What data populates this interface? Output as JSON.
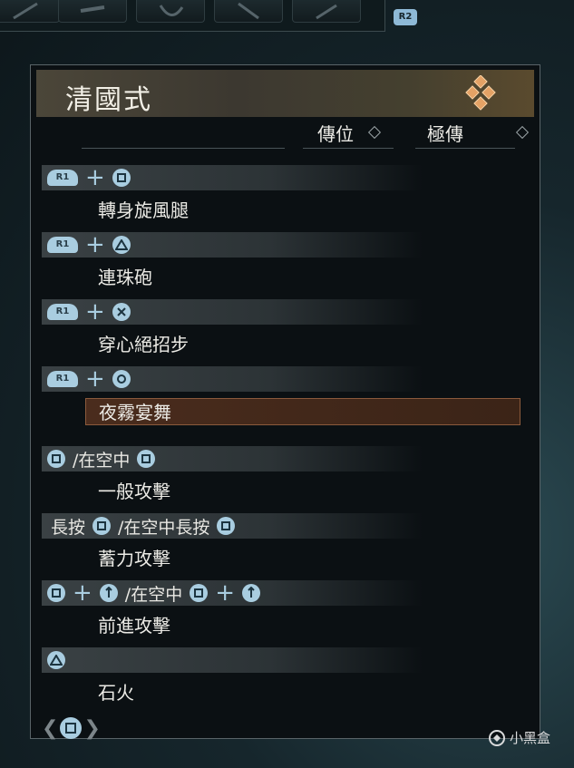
{
  "top_bar": {
    "slot_count": 5,
    "r2_label": "R2"
  },
  "panel": {
    "title": "清國式",
    "tabs": [
      "傳位",
      "極傳"
    ],
    "moves": [
      {
        "keys": "R1 + □",
        "name": "轉身旋風腿"
      },
      {
        "keys": "R1 + △",
        "name": "連珠砲"
      },
      {
        "keys": "R1 + ×",
        "name": "穿心絕招步"
      },
      {
        "keys": "R1 + ○",
        "name": "夜霧宴舞",
        "selected": true
      },
      {
        "keys": "□ /在空中 □",
        "name": "一般攻擊"
      },
      {
        "keys": "長按 □ /在空中長按 □",
        "name": "蓄力攻擊"
      },
      {
        "keys": "□ + L /在空中 □ + L",
        "name": "前進攻擊"
      },
      {
        "keys": "△",
        "name": "石火"
      }
    ],
    "key_texts": {
      "air": "/在空中",
      "hold": "長按",
      "air_hold": "/在空中長按",
      "r1": "R1"
    }
  },
  "bottom": {
    "nav_prev": "❮",
    "nav_next": "❯"
  },
  "watermark": {
    "text": "小黑盒"
  }
}
